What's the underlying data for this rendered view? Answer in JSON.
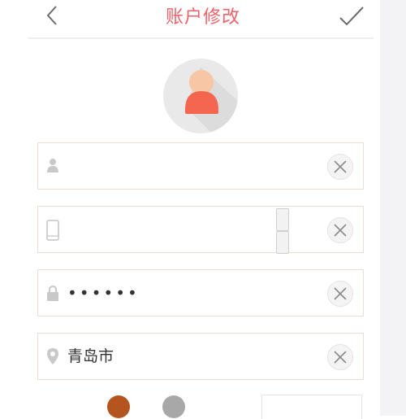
{
  "header": {
    "title": "账户修改",
    "back_icon": "chevron-left-icon",
    "confirm_icon": "checkmark-icon"
  },
  "avatar": {
    "icon": "user-avatar-icon"
  },
  "fields": {
    "username": {
      "value": "",
      "icon": "person-icon"
    },
    "phone": {
      "value": "",
      "icon": "mobile-phone-icon"
    },
    "password": {
      "value": "••••••",
      "icon": "lock-icon"
    },
    "city": {
      "value": "青岛市",
      "icon": "location-pin-icon"
    }
  },
  "colors": {
    "accent": "#f0626a",
    "field_border": "#eadfd1",
    "avatar_body": "#f4664f",
    "avatar_head": "#f7c6a4"
  }
}
